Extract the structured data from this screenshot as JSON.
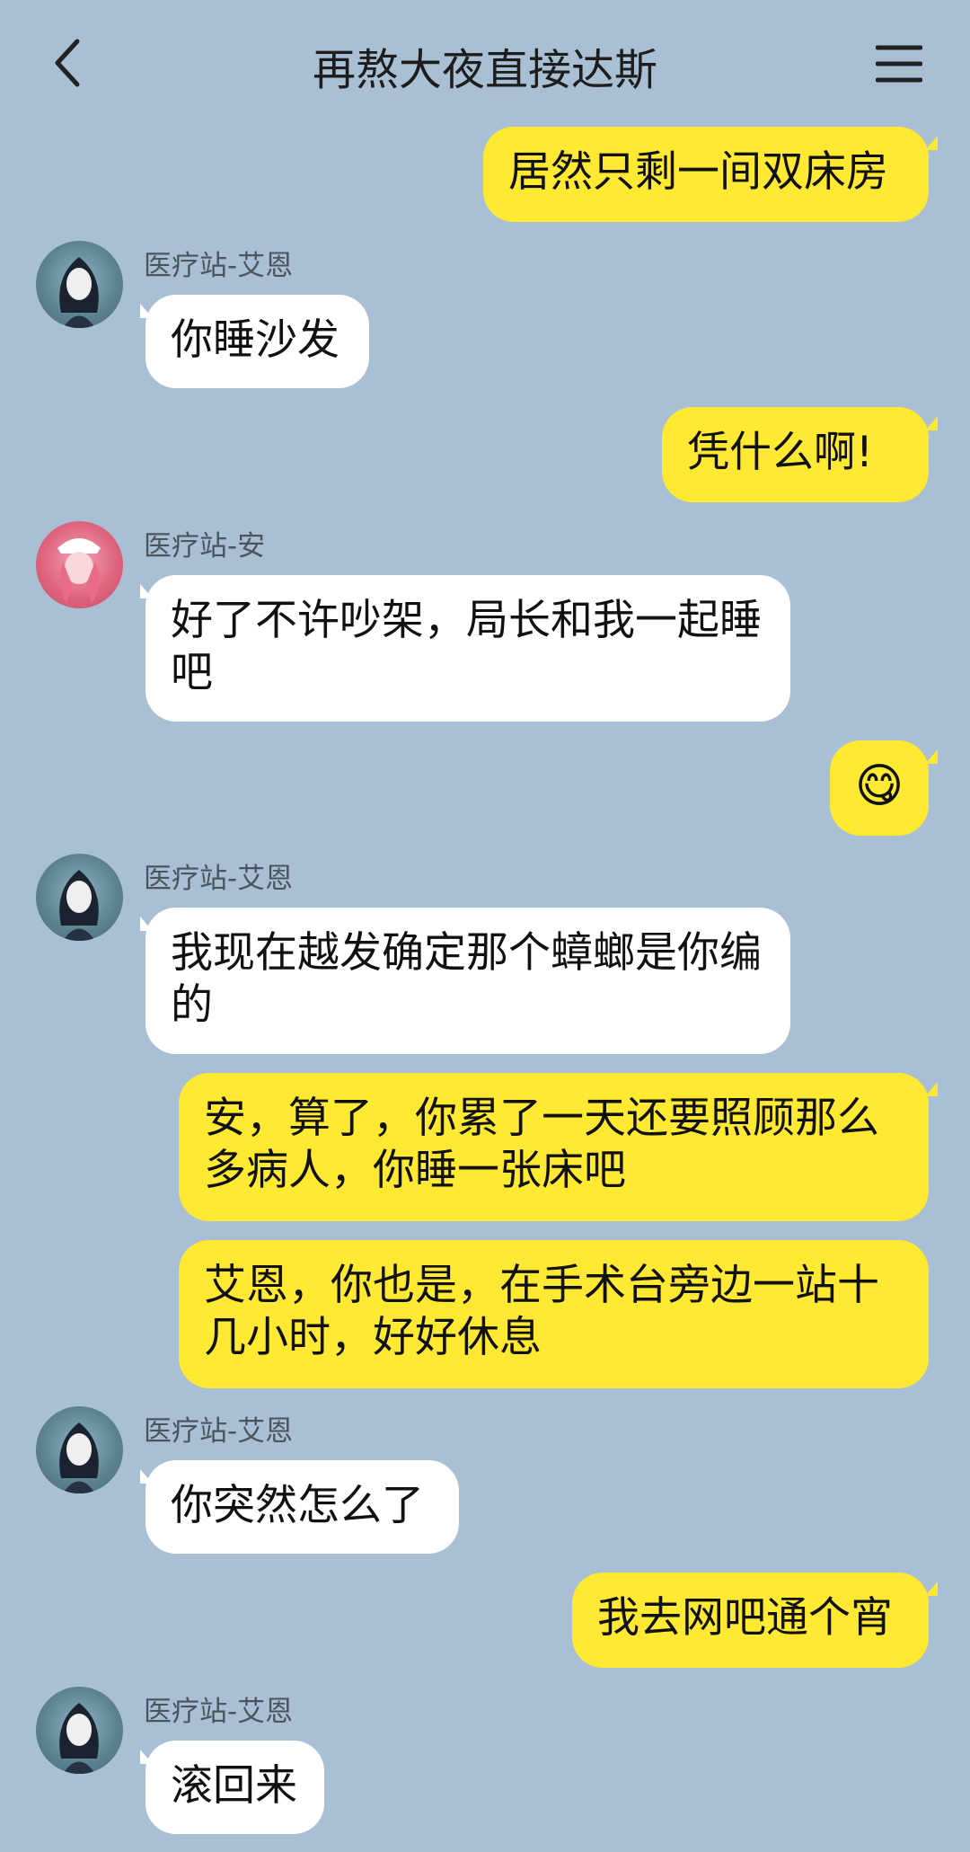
{
  "header": {
    "title": "再熬大夜直接达斯",
    "back_icon": "chevron-left-icon",
    "menu_icon": "hamburger-menu-icon"
  },
  "messages": [
    {
      "side": "right",
      "text": "居然只剩一间双床房"
    },
    {
      "side": "left",
      "sender": "医疗站-艾恩",
      "avatar": "dark",
      "text": "你睡沙发"
    },
    {
      "side": "right",
      "text": "凭什么啊!"
    },
    {
      "side": "left",
      "sender": "医疗站-安",
      "avatar": "pink",
      "text": "好了不许吵架，局长和我一起睡吧"
    },
    {
      "side": "right",
      "text": "😋"
    },
    {
      "side": "left",
      "sender": "医疗站-艾恩",
      "avatar": "dark",
      "text": "我现在越发确定那个蟑螂是你编的"
    },
    {
      "side": "right",
      "text": "安，算了，你累了一天还要照顾那么多病人，你睡一张床吧"
    },
    {
      "side": "right",
      "text": "艾恩，你也是，在手术台旁边一站十几小时，好好休息"
    },
    {
      "side": "left",
      "sender": "医疗站-艾恩",
      "avatar": "dark",
      "text": "你突然怎么了"
    },
    {
      "side": "right",
      "text": "我去网吧通个宵"
    },
    {
      "side": "left",
      "sender": "医疗站-艾恩",
      "avatar": "dark",
      "text": "滚回来"
    }
  ],
  "colors": {
    "background": "#a9bfd3",
    "self_bubble": "#ffe933",
    "other_bubble": "#ffffff"
  }
}
